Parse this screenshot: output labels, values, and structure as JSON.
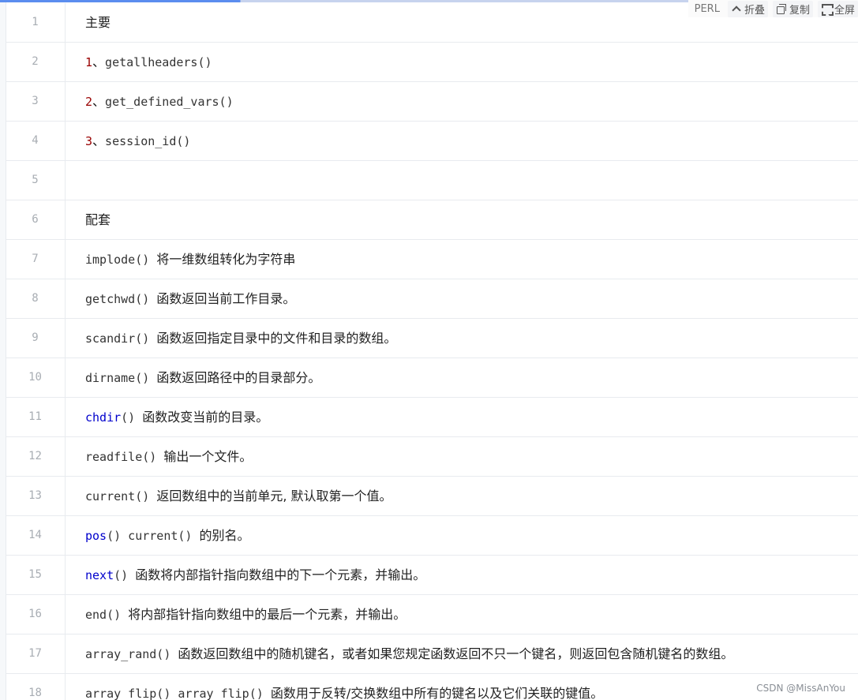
{
  "toolbar": {
    "language": "PERL",
    "fold_label": "折叠",
    "copy_label": "复制",
    "fullscreen_label": "全屏"
  },
  "lines": [
    {
      "num": "1",
      "parts": [
        {
          "t": "主要",
          "c": "cjk"
        }
      ]
    },
    {
      "num": "2",
      "parts": [
        {
          "t": "1",
          "c": "mono num"
        },
        {
          "t": "、",
          "c": "cjk"
        },
        {
          "t": "getallheaders()",
          "c": "mono"
        }
      ]
    },
    {
      "num": "3",
      "parts": [
        {
          "t": "2",
          "c": "mono num"
        },
        {
          "t": "、",
          "c": "cjk"
        },
        {
          "t": "get_defined_vars()",
          "c": "mono"
        }
      ]
    },
    {
      "num": "4",
      "parts": [
        {
          "t": "3",
          "c": "mono num"
        },
        {
          "t": "、",
          "c": "cjk"
        },
        {
          "t": "session_id()",
          "c": "mono"
        }
      ]
    },
    {
      "num": "5",
      "parts": []
    },
    {
      "num": "6",
      "parts": [
        {
          "t": "配套",
          "c": "cjk"
        }
      ]
    },
    {
      "num": "7",
      "parts": [
        {
          "t": "implode() ",
          "c": "mono"
        },
        {
          "t": "将一维数组转化为字符串",
          "c": "cjk"
        }
      ]
    },
    {
      "num": "8",
      "parts": [
        {
          "t": "getchwd() ",
          "c": "mono"
        },
        {
          "t": "函数返回当前工作目录。",
          "c": "cjk"
        }
      ]
    },
    {
      "num": "9",
      "parts": [
        {
          "t": "scandir() ",
          "c": "mono"
        },
        {
          "t": "函数返回指定目录中的文件和目录的数组。",
          "c": "cjk"
        }
      ]
    },
    {
      "num": "10",
      "parts": [
        {
          "t": "dirname() ",
          "c": "mono"
        },
        {
          "t": "函数返回路径中的目录部分。",
          "c": "cjk"
        }
      ]
    },
    {
      "num": "11",
      "parts": [
        {
          "t": "chdir",
          "c": "mono kw"
        },
        {
          "t": "() ",
          "c": "mono"
        },
        {
          "t": "函数改变当前的目录。",
          "c": "cjk"
        }
      ]
    },
    {
      "num": "12",
      "parts": [
        {
          "t": "readfile() ",
          "c": "mono"
        },
        {
          "t": "输出一个文件。",
          "c": "cjk"
        }
      ]
    },
    {
      "num": "13",
      "parts": [
        {
          "t": "current() ",
          "c": "mono"
        },
        {
          "t": "返回数组中的当前单元, 默认取第一个值。",
          "c": "cjk"
        }
      ]
    },
    {
      "num": "14",
      "parts": [
        {
          "t": "pos",
          "c": "mono kw"
        },
        {
          "t": "() current() ",
          "c": "mono"
        },
        {
          "t": "的别名。",
          "c": "cjk"
        }
      ]
    },
    {
      "num": "15",
      "parts": [
        {
          "t": "next",
          "c": "mono kw"
        },
        {
          "t": "() ",
          "c": "mono"
        },
        {
          "t": "函数将内部指针指向数组中的下一个元素，并输出。",
          "c": "cjk"
        }
      ]
    },
    {
      "num": "16",
      "parts": [
        {
          "t": "end() ",
          "c": "mono"
        },
        {
          "t": "将内部指针指向数组中的最后一个元素，并输出。",
          "c": "cjk"
        }
      ]
    },
    {
      "num": "17",
      "parts": [
        {
          "t": "array_rand() ",
          "c": "mono"
        },
        {
          "t": "函数返回数组中的随机键名，或者如果您规定函数返回不只一个键名，则返回包含随机键名的数组。",
          "c": "cjk"
        }
      ]
    },
    {
      "num": "18",
      "parts": [
        {
          "t": "array_flip() array_flip() ",
          "c": "mono"
        },
        {
          "t": "函数用于反转/交换数组中所有的键名以及它们关联的键值。",
          "c": "cjk"
        }
      ]
    }
  ],
  "watermark": "CSDN @MissAnYou"
}
